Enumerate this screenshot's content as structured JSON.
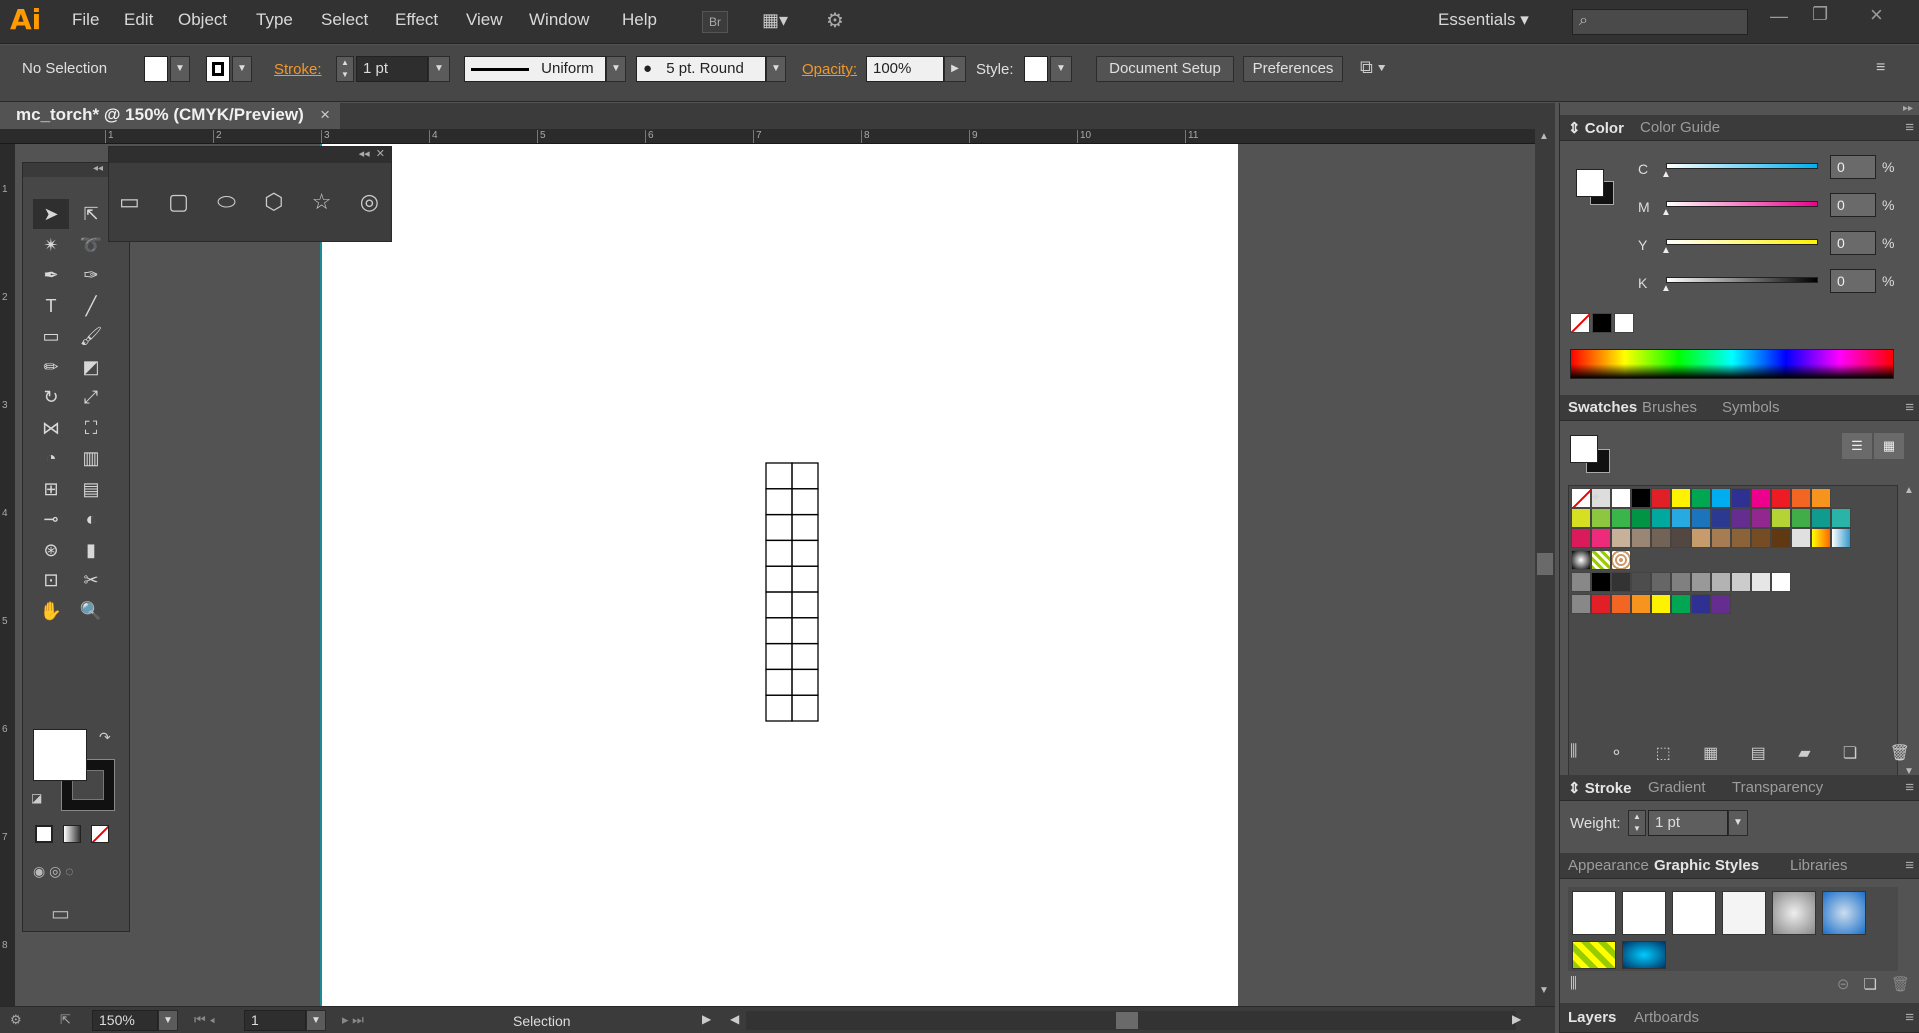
{
  "app": {
    "logo": "Ai"
  },
  "menu": [
    "File",
    "Edit",
    "Object",
    "Type",
    "Select",
    "Effect",
    "View",
    "Window",
    "Help"
  ],
  "menu_right": {
    "bridge": "Br",
    "workspace": "Essentials",
    "search_placeholder": ""
  },
  "control": {
    "selection": "No Selection",
    "stroke_label": "Stroke:",
    "stroke_weight": "1 pt",
    "profile": "Uniform",
    "brush": "5 pt. Round",
    "opacity_label": "Opacity:",
    "opacity": "100%",
    "style_label": "Style:",
    "doc_setup": "Document Setup",
    "preferences": "Preferences"
  },
  "document": {
    "tab_title": "mc_torch* @ 150% (CMYK/Preview)",
    "close": "×"
  },
  "rulers": {
    "h": [
      "1",
      "2",
      "3",
      "4",
      "5",
      "6",
      "7",
      "8",
      "9",
      "10",
      "11"
    ],
    "v": [
      "1",
      "2",
      "3",
      "4",
      "5",
      "6",
      "7",
      "8"
    ]
  },
  "grid": {
    "rows": 10,
    "cols": 2
  },
  "color_panel": {
    "tabs": [
      "Color",
      "Color Guide"
    ],
    "channels": [
      {
        "name": "C",
        "value": "0",
        "unit": "%"
      },
      {
        "name": "M",
        "value": "0",
        "unit": "%"
      },
      {
        "name": "Y",
        "value": "0",
        "unit": "%"
      },
      {
        "name": "K",
        "value": "0",
        "unit": "%"
      }
    ]
  },
  "swatches_panel": {
    "tabs": [
      "Swatches",
      "Brushes",
      "Symbols"
    ]
  },
  "swatch_colors": {
    "row1": [
      "#000000",
      "#e01f26",
      "#fff200",
      "#00a651",
      "#00aeef",
      "#2e3192",
      "#ec008c",
      "#ed1c24",
      "#f26522",
      "#f7941d"
    ],
    "row2": [
      "#d7df23",
      "#8dc63f",
      "#39b54a",
      "#009444",
      "#00a99d",
      "#27aae1",
      "#1c75bc",
      "#2b3990",
      "#662d91",
      "#92278f"
    ],
    "row3": [
      "#d91b5c",
      "#ee2a7b",
      "#c7b299",
      "#998675",
      "#736357",
      "#534741",
      "#c69c6d",
      "#a67c52",
      "#8c6239",
      "#754c24"
    ],
    "row5": [
      "#000000",
      "#333333",
      "#4d4d4d",
      "#666666",
      "#808080",
      "#999999",
      "#b3b3b3",
      "#cccccc",
      "#e6e6e6",
      "#ffffff"
    ],
    "row6": [
      "#e01f26",
      "#f26522",
      "#f7941d",
      "#fff200",
      "#00a651",
      "#2e3192",
      "#662d91"
    ]
  },
  "stroke_panel": {
    "tabs": [
      "Stroke",
      "Gradient",
      "Transparency"
    ],
    "weight_label": "Weight:",
    "weight": "1 pt"
  },
  "styles_panel": {
    "tabs": [
      "Appearance",
      "Graphic Styles",
      "Libraries"
    ]
  },
  "layers_panel": {
    "tabs": [
      "Layers",
      "Artboards"
    ]
  },
  "status": {
    "zoom": "150%",
    "artboard": "1",
    "tool": "Selection"
  }
}
